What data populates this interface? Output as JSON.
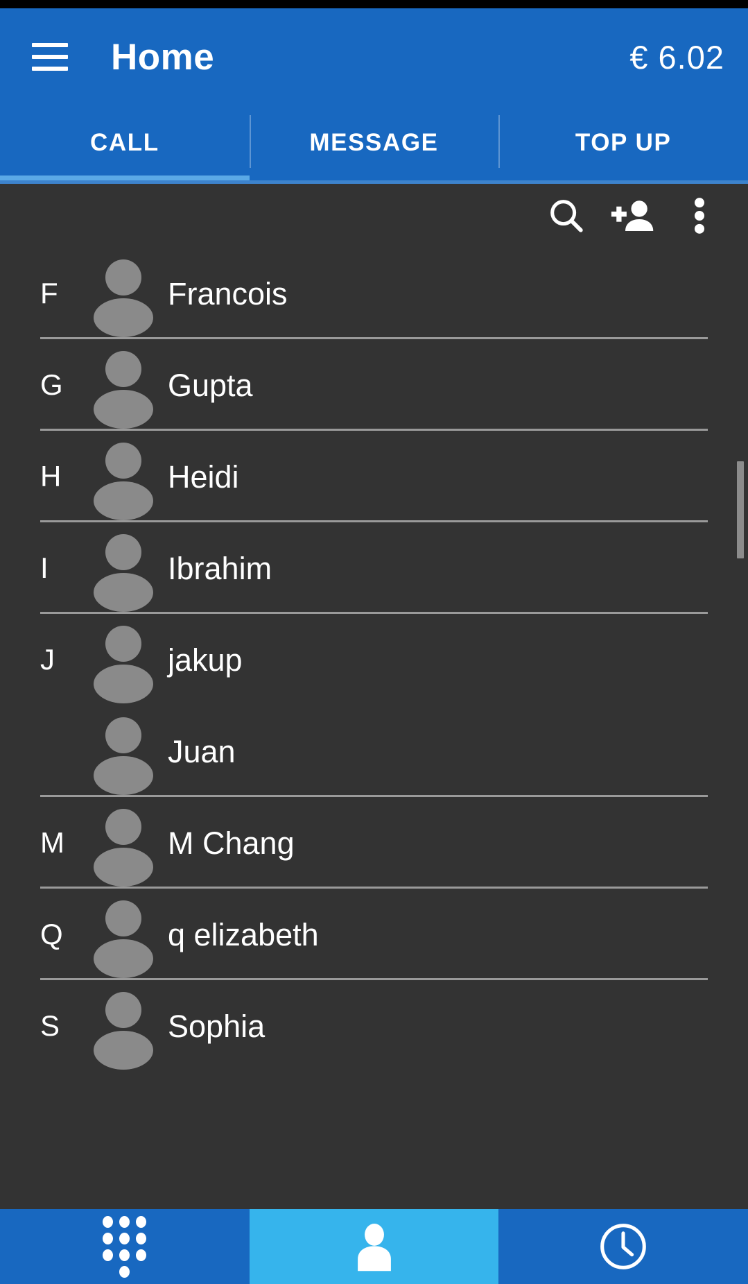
{
  "app": {
    "title": "Home",
    "balance": "€ 6.02",
    "menu_icon": "hamburger-menu-icon"
  },
  "tabs": {
    "items": [
      {
        "label": "CALL",
        "active": true
      },
      {
        "label": "MESSAGE",
        "active": false
      },
      {
        "label": "TOP UP",
        "active": false
      }
    ],
    "active_index": 0,
    "indicator_color": "#5aa9e6"
  },
  "list_toolbar": {
    "icons": [
      {
        "name": "search-icon",
        "label": "Search"
      },
      {
        "name": "add-contact-icon",
        "label": "Add contact"
      },
      {
        "name": "overflow-menu-icon",
        "label": "More options"
      }
    ]
  },
  "contacts": {
    "rows": [
      {
        "section": "F",
        "name": "Francois",
        "divider": true
      },
      {
        "section": "G",
        "name": "Gupta",
        "divider": true
      },
      {
        "section": "H",
        "name": "Heidi",
        "divider": true
      },
      {
        "section": "I",
        "name": "Ibrahim",
        "divider": true
      },
      {
        "section": "J",
        "name": "jakup",
        "divider": false
      },
      {
        "section": "",
        "name": "Juan",
        "divider": true
      },
      {
        "section": "M",
        "name": "M Chang",
        "divider": true
      },
      {
        "section": "Q",
        "name": "q elizabeth",
        "divider": true
      },
      {
        "section": "S",
        "name": "Sophia",
        "divider": false
      }
    ]
  },
  "bottom_nav": {
    "items": [
      {
        "name": "dialpad-tab",
        "icon": "dialpad-icon",
        "label": "Dialpad",
        "active": false
      },
      {
        "name": "contacts-tab",
        "icon": "person-icon",
        "label": "Contacts",
        "active": true
      },
      {
        "name": "recents-tab",
        "icon": "clock-icon",
        "label": "Recents",
        "active": false
      }
    ]
  },
  "colors": {
    "header_blue": "#1868c0",
    "accent_light_blue": "#36b4ec",
    "content_dark": "#333333",
    "avatar_gray": "#8a8a8a",
    "divider_gray": "#9a9a9a"
  }
}
